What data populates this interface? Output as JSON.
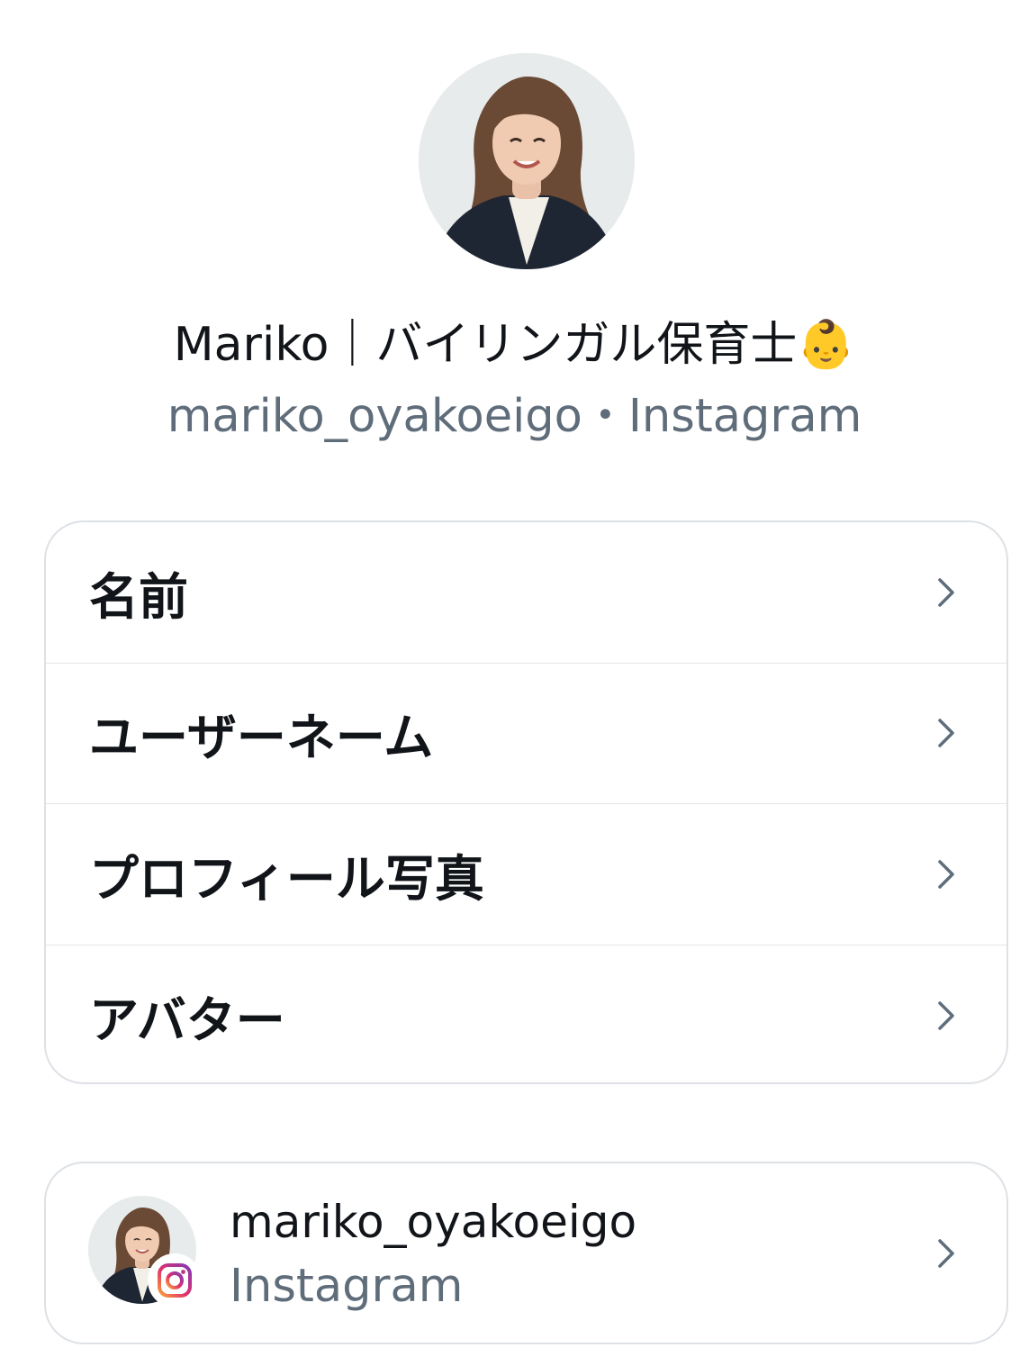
{
  "profile": {
    "avatar_icon": "profile-photo",
    "display_name": "Mariko｜バイリンガル保育士👶",
    "subtitle": "mariko_oyakoeigo・Instagram"
  },
  "settings": {
    "items": [
      {
        "label": "名前",
        "icon": "chevron-right-icon"
      },
      {
        "label": "ユーザーネーム",
        "icon": "chevron-right-icon"
      },
      {
        "label": "プロフィール写真",
        "icon": "chevron-right-icon"
      },
      {
        "label": "アバター",
        "icon": "chevron-right-icon"
      }
    ]
  },
  "account": {
    "username": "mariko_oyakoeigo",
    "platform": "Instagram",
    "badge_icon": "instagram-icon"
  },
  "colors": {
    "text_primary": "#111418",
    "text_secondary": "#5f6c7a",
    "border": "#dde1e6",
    "chevron": "#5f6c7a"
  }
}
